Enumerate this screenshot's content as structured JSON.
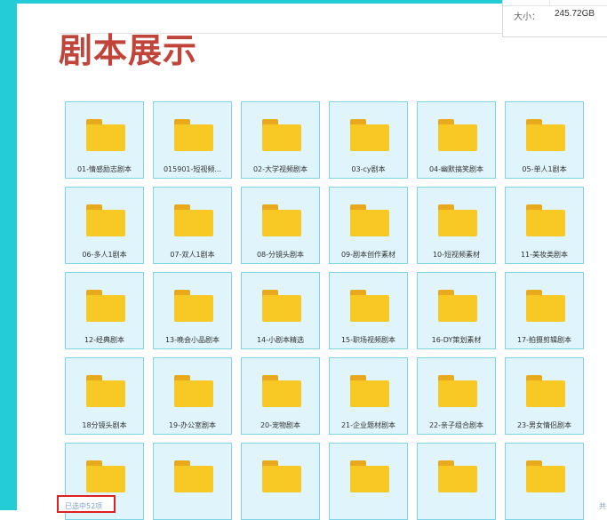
{
  "page": {
    "title": "剧本展示"
  },
  "info_panel": {
    "size_label": "大小：",
    "size_value": "245.72GB"
  },
  "folders": [
    "01-情感励志剧本",
    "015901-短视频...",
    "02-大学视频剧本",
    "03-cy剧本",
    "04-幽默搞笑剧本",
    "05-单人1剧本",
    "06-多人1剧本",
    "07-双人1剧本",
    "08-分镜头剧本",
    "09-剧本创作素材",
    "10-短视频素材",
    "11-美妆类剧本",
    "12-经典剧本",
    "13-晚会小品剧本",
    "14-小剧本精选",
    "15-职场视频剧本",
    "16-DY策划素材",
    "17-拍摄剪辑剧本",
    "18分镜头剧本",
    "19-办公室剧本",
    "20-宠物剧本",
    "21-企业题材剧本",
    "22-亲子组合剧本",
    "23-男女情侣剧本",
    "",
    "",
    "",
    "",
    "",
    ""
  ],
  "status_bar": {
    "selected_text": "已选中52项",
    "corner_text": "共"
  },
  "colors": {
    "accent": "#23ccd6",
    "title": "#c1443a",
    "tile_bg": "#dff4fb",
    "tile_border": "#7fd4e6",
    "folder": "#f8c824",
    "highlight": "#e02020"
  }
}
